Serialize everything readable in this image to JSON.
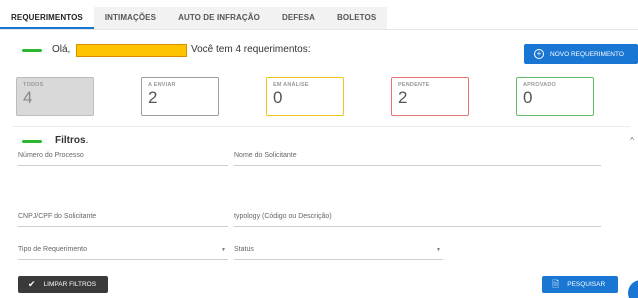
{
  "tabs": [
    {
      "label": "REQUERIMENTOS",
      "active": true
    },
    {
      "label": "INTIMAÇÕES",
      "active": false
    },
    {
      "label": "AUTO DE INFRAÇÃO",
      "active": false
    },
    {
      "label": "DEFESA",
      "active": false
    },
    {
      "label": "BOLETOS",
      "active": false
    }
  ],
  "greeting": {
    "hello": "Olá,",
    "message": "Você tem 4 requerimentos:"
  },
  "new_request_button": {
    "label": "NOVO REQUERIMENTO",
    "icon": "plus-circle-icon"
  },
  "status_cards": [
    {
      "label": "TODOS",
      "count": "4",
      "border": "#bcbcbc"
    },
    {
      "label": "A ENVIAR",
      "count": "2",
      "border": "#9e9e9e"
    },
    {
      "label": "EM ANÁLISE",
      "count": "0",
      "border": "#f0c419"
    },
    {
      "label": "PENDENTE",
      "count": "2",
      "border": "#e57373"
    },
    {
      "label": "APROVADO",
      "count": "0",
      "border": "#66bb6a"
    }
  ],
  "filters": {
    "title": "Filtros",
    "numero_processo": "Número do Processo",
    "nome_solicitante": "Nome do Solicitante",
    "cnpj_cpf": "CNPJ/CPF do Solicitante",
    "typology": "typology (Código ou Descrição)",
    "tipo_requerimento": "Tipo de Requerimento",
    "status": "Status"
  },
  "buttons": {
    "clear": "LIMPAR FILTROS",
    "search": "PESQUISAR"
  },
  "colors": {
    "accent": "#1976d2",
    "green": "#2eb82e",
    "name_highlight": "#ffc400"
  }
}
